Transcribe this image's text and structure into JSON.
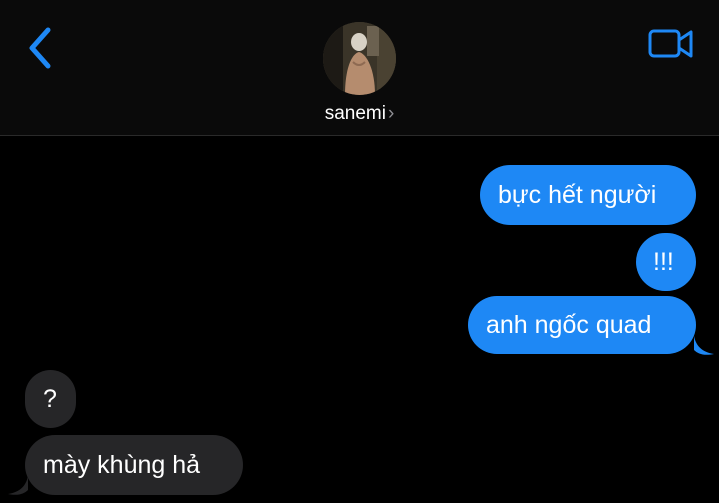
{
  "header": {
    "contact_name": "sanemi",
    "chevron": "›",
    "back_icon": "chevron-left-icon",
    "video_icon": "video-camera-icon",
    "accent_color": "#1e88f5"
  },
  "messages": [
    {
      "direction": "sent",
      "text": "bực hết người"
    },
    {
      "direction": "sent",
      "text": "!!!"
    },
    {
      "direction": "sent",
      "text": "anh ngốc quad"
    },
    {
      "direction": "received",
      "text": "?"
    },
    {
      "direction": "received",
      "text": "mày khùng hả"
    }
  ],
  "colors": {
    "sent_bubble": "#1e88f5",
    "received_bubble": "#262628",
    "background": "#000000"
  }
}
